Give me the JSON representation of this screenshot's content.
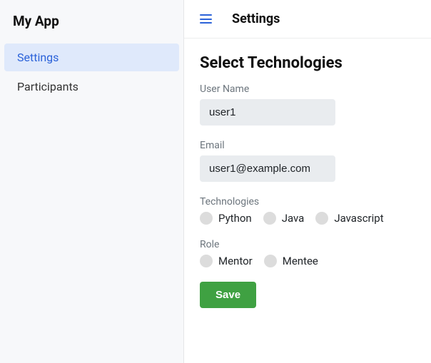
{
  "app_title": "My App",
  "sidebar": {
    "items": [
      {
        "label": "Settings",
        "active": true
      },
      {
        "label": "Participants",
        "active": false
      }
    ]
  },
  "topbar": {
    "title": "Settings"
  },
  "section": {
    "title": "Select Technologies"
  },
  "form": {
    "username": {
      "label": "User Name",
      "value": "user1"
    },
    "email": {
      "label": "Email",
      "value": "user1@example.com"
    },
    "technologies": {
      "label": "Technologies",
      "options": [
        {
          "label": "Python"
        },
        {
          "label": "Java"
        },
        {
          "label": "Javascript"
        }
      ]
    },
    "role": {
      "label": "Role",
      "options": [
        {
          "label": "Mentor"
        },
        {
          "label": "Mentee"
        }
      ]
    },
    "save_label": "Save"
  }
}
